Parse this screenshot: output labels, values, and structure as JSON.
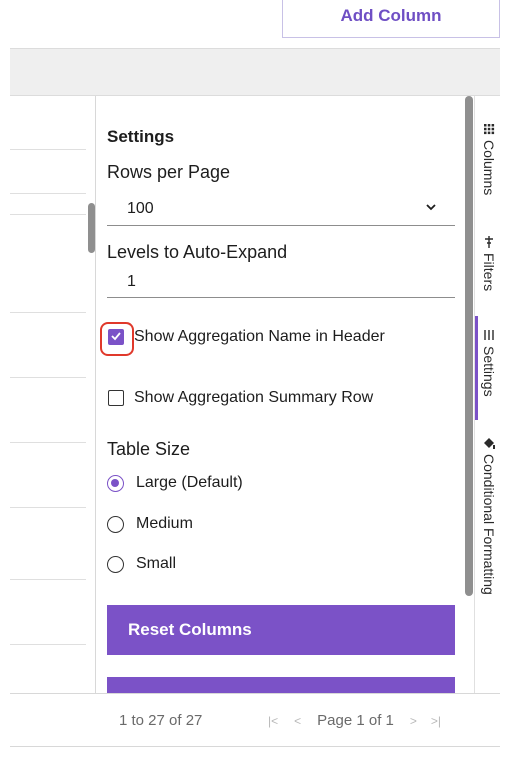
{
  "toolbar": {
    "add_column_label": "Add Column"
  },
  "settings": {
    "title": "Settings",
    "rows_per_page_label": "Rows per Page",
    "rows_per_page_value": "100",
    "levels_label": "Levels to Auto-Expand",
    "levels_value": "1",
    "show_agg_name_label": "Show Aggregation Name in Header",
    "show_agg_name_checked": true,
    "show_agg_summary_label": "Show Aggregation Summary Row",
    "show_agg_summary_checked": false,
    "table_size_label": "Table Size",
    "table_size_options": [
      "Large (Default)",
      "Medium",
      "Small"
    ],
    "table_size_selected": "Large (Default)",
    "reset_label": "Reset Columns"
  },
  "side_tabs": [
    {
      "label": "Columns",
      "icon": "columns-icon"
    },
    {
      "label": "Filters",
      "icon": "filter-icon"
    },
    {
      "label": "Settings",
      "icon": "settings-list-icon",
      "active": true
    },
    {
      "label": "Conditional Formatting",
      "icon": "paint-bucket-icon"
    }
  ],
  "footer": {
    "summary": "1 to 27 of 27",
    "page_label": "Page 1 of 1"
  },
  "colors": {
    "accent": "#7b52c7",
    "highlight": "#e0392b"
  }
}
